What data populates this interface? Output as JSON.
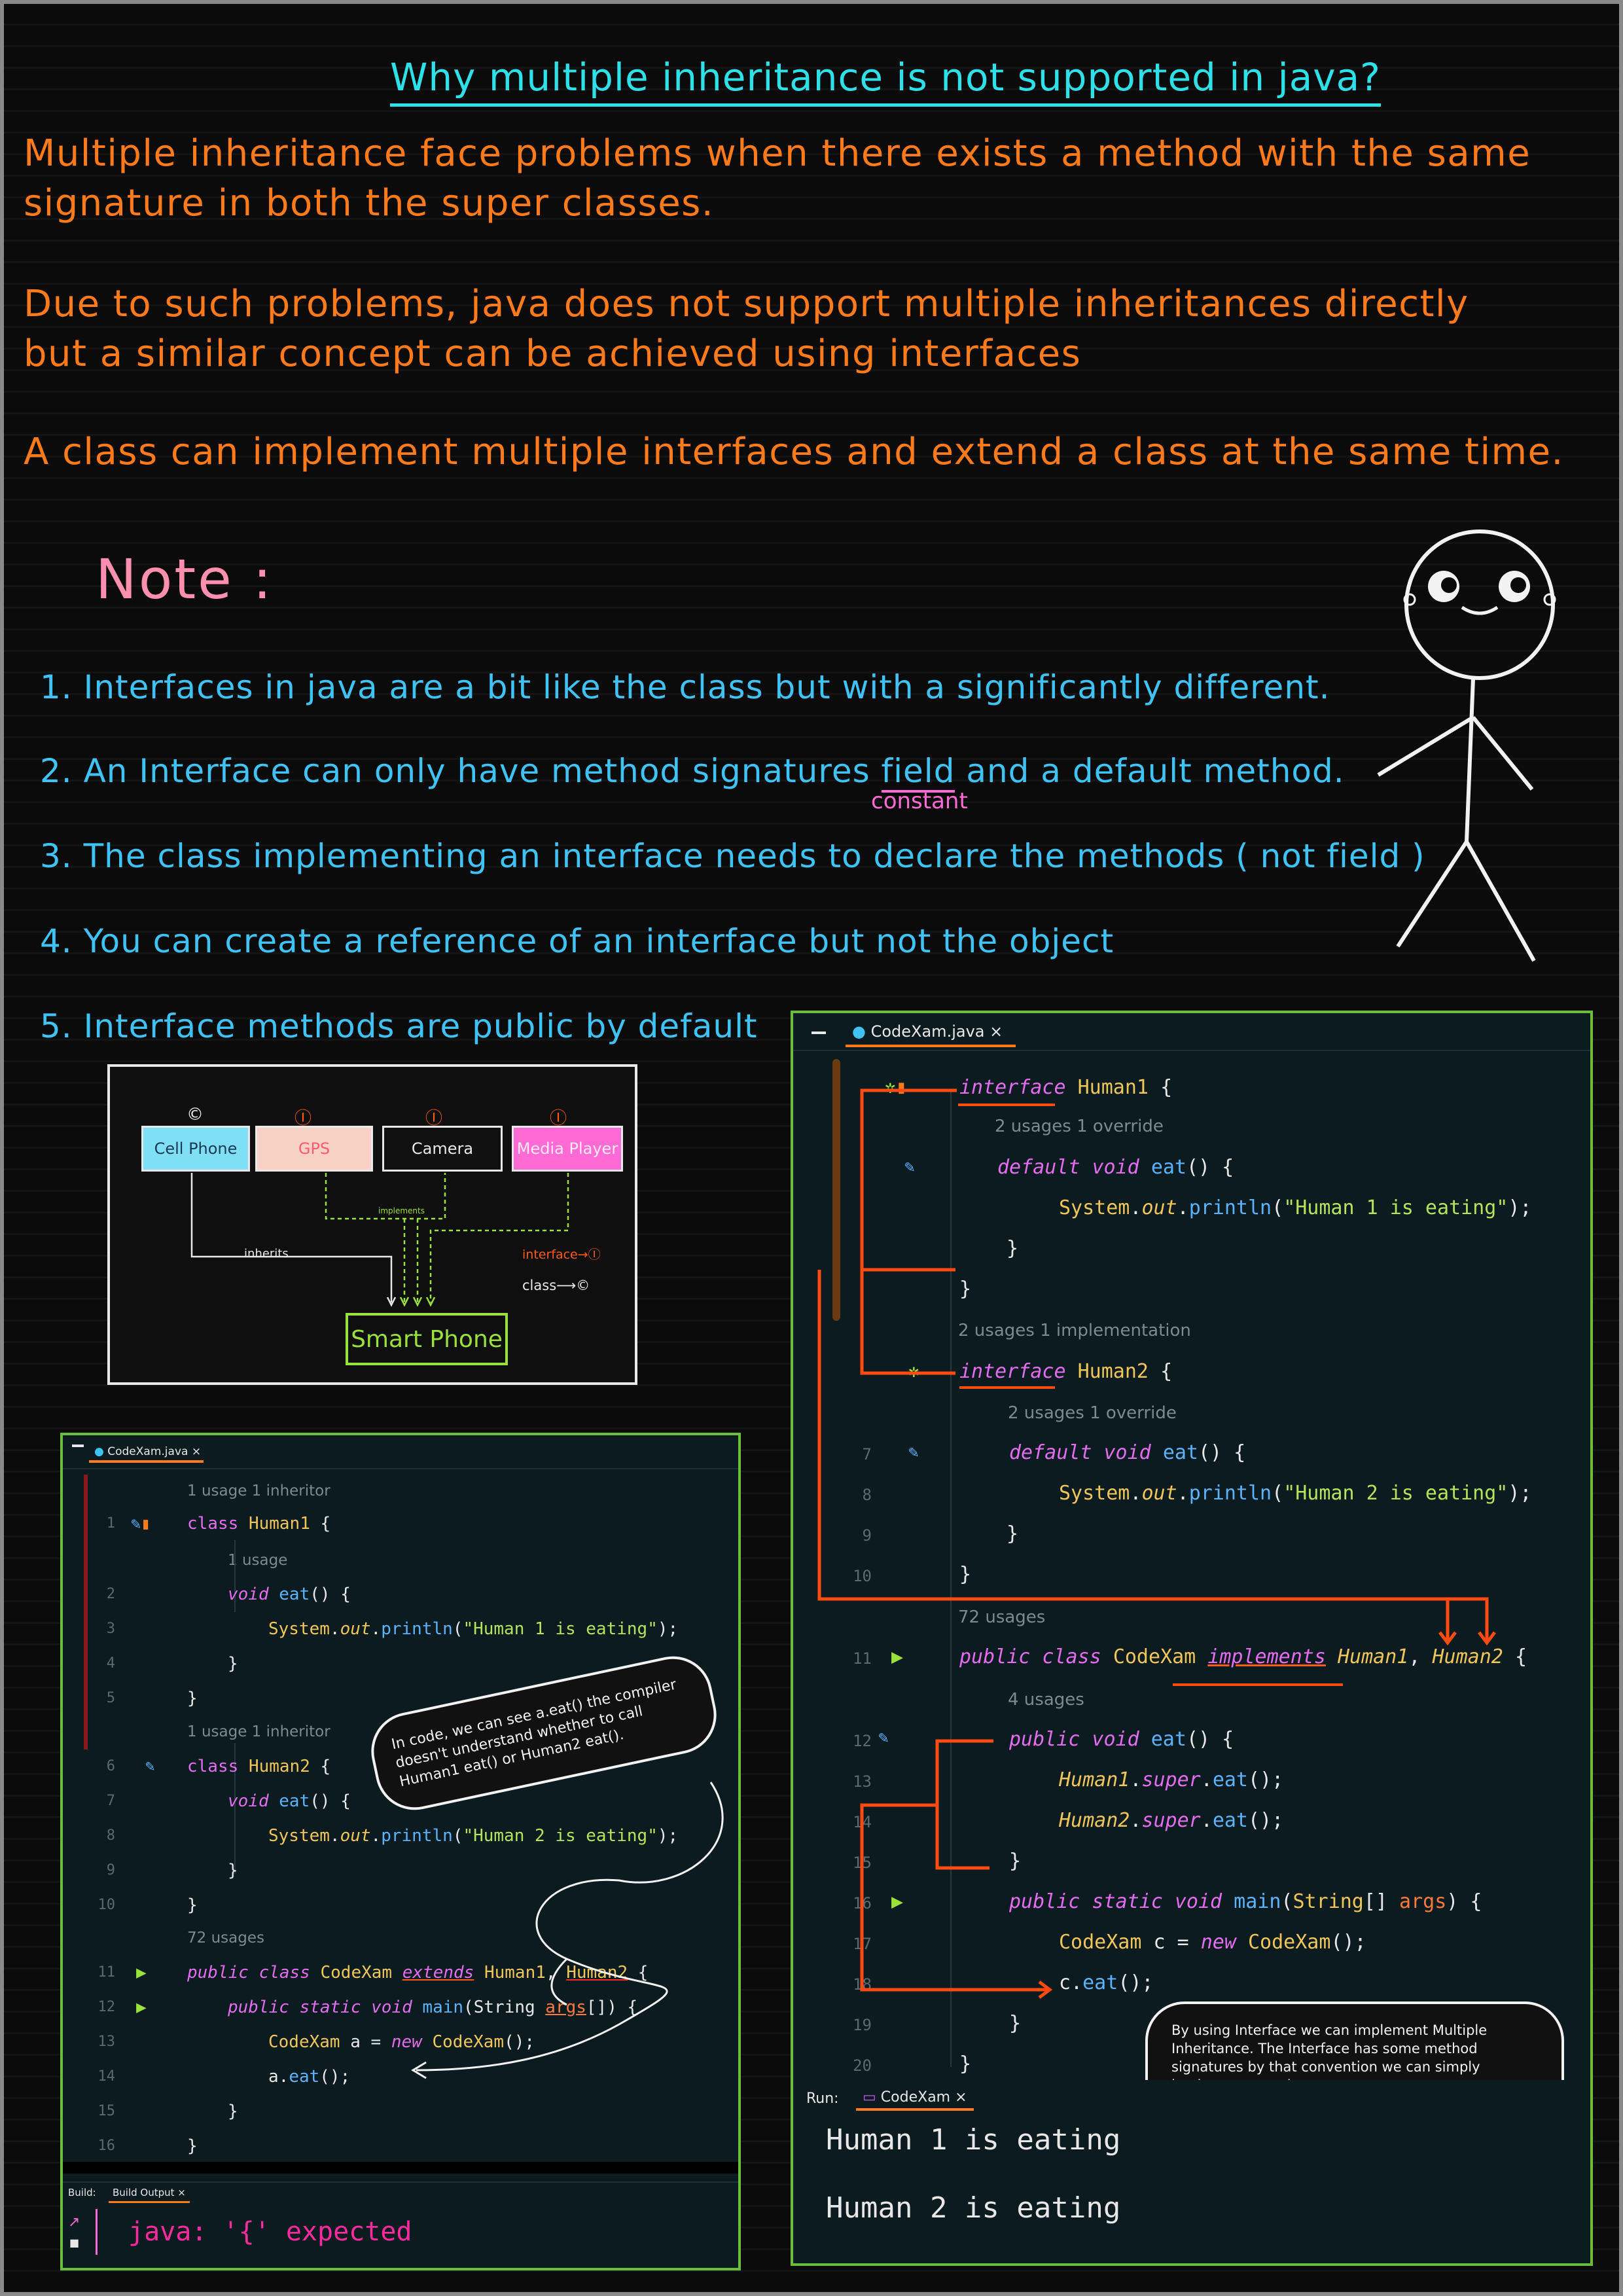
{
  "title": "Why multiple inheritance is not supported in java?",
  "intro": [
    "Multiple inheritance face problems when there exists a method with the same",
    "signature in both the super classes.",
    "Due to such problems, java does not support multiple inheritances directly",
    "but a similar concept can be achieved using interfaces",
    "A class can implement multiple interfaces and extend a class at the same time."
  ],
  "note": {
    "heading": "Note :",
    "items": [
      "1. Interfaces in java are a bit like the class but with a significantly different.",
      "2. An Interface can only have method signatures",
      "field",
      "and a default method.",
      "3. The class implementing an interface needs to declare the methods ( not field )",
      "4. You can create a reference of an interface but not the object",
      "5. Interface methods are public by default"
    ],
    "annotation": "constant"
  },
  "diagram": {
    "boxes": [
      "Cell Phone",
      "GPS",
      "Camera",
      "Media Player"
    ],
    "marks": [
      "©",
      "Ⓘ",
      "Ⓘ",
      "Ⓘ"
    ],
    "inherits": "inherits",
    "implements": "implements",
    "legend_interface": "interface→Ⓘ",
    "legend_class": "class⟶©",
    "result": "Smart Phone",
    "colors": {
      "cell": "#7fe0f5",
      "gps": "#f7d2c4",
      "camera": "#111111",
      "media": "#ff6ad5",
      "smart": "#9be13c"
    }
  },
  "left_panel": {
    "tab": "CodeXam.java ×",
    "hints": [
      "1 usage   1 inheritor",
      "1 usage",
      "1 usage   1 inheritor",
      "72 usages"
    ],
    "line_numbers": [
      "1",
      "2",
      "3",
      "4",
      "5",
      "6",
      "7",
      "8",
      "9",
      "10",
      "11",
      "12",
      "13",
      "14",
      "15",
      "16"
    ],
    "bubble": "In code, we can see a.eat() the compiler doesn't understand whether to call Human1 eat() or Human2 eat().",
    "build_labels": [
      "Build:",
      "Build Output ×"
    ],
    "error": "java: '{' expected"
  },
  "right_panel": {
    "tab": "CodeXam.java ×",
    "hints": [
      "2 usages   1 override",
      "2 usages   1 implementation",
      "2 usages   1 override",
      "72 usages",
      "4 usages"
    ],
    "line_numbers": [
      "7",
      "8",
      "9",
      "10",
      "11",
      "12",
      "13",
      "14",
      "15",
      "16",
      "17",
      "18",
      "19",
      "20"
    ],
    "bubble": "By using Interface we can implement Multiple Inheritance. The Interface has some method signatures by that convention we can simply implement any class.",
    "run_label": "Run:",
    "run_tab": "CodeXam ×",
    "output": [
      "Human 1 is eating",
      "Human 2 is eating"
    ]
  }
}
